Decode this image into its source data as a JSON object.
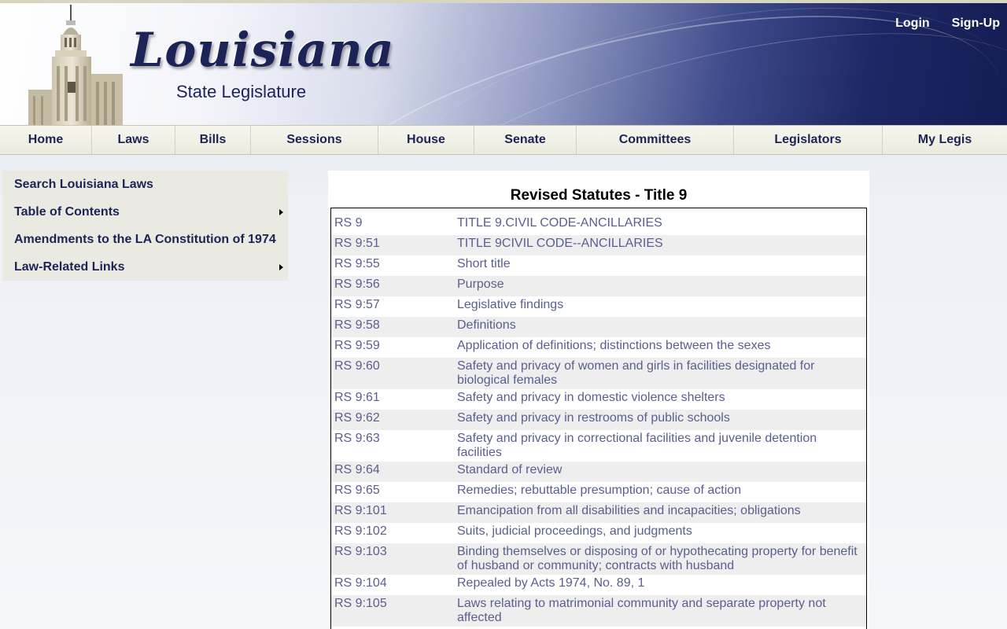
{
  "header": {
    "logo_title": "Louisiana",
    "logo_subtitle": "State Legislature",
    "login": "Login",
    "signup": "Sign-Up"
  },
  "nav": [
    {
      "label": "Home"
    },
    {
      "label": "Laws"
    },
    {
      "label": "Bills"
    },
    {
      "label": "Sessions"
    },
    {
      "label": "House"
    },
    {
      "label": "Senate"
    },
    {
      "label": "Committees"
    },
    {
      "label": "Legislators"
    },
    {
      "label": "My Legis"
    }
  ],
  "leftmenu": [
    {
      "label": "Search Louisiana Laws",
      "has_submenu": false
    },
    {
      "label": "Table of Contents",
      "has_submenu": true
    },
    {
      "label": "Amendments to the LA Constitution of 1974",
      "has_submenu": false
    },
    {
      "label": "Law-Related Links",
      "has_submenu": true
    }
  ],
  "content": {
    "title": "Revised Statutes - Title 9",
    "rows": [
      {
        "code": "RS 9",
        "title": "TITLE 9.CIVIL CODE-ANCILLARIES"
      },
      {
        "code": "RS 9:51",
        "title": "TITLE 9CIVIL CODE--ANCILLARIES"
      },
      {
        "code": "RS 9:55",
        "title": "Short title"
      },
      {
        "code": "RS 9:56",
        "title": "Purpose"
      },
      {
        "code": "RS 9:57",
        "title": "Legislative findings"
      },
      {
        "code": "RS 9:58",
        "title": "Definitions"
      },
      {
        "code": "RS 9:59",
        "title": "Application of definitions; distinctions between the sexes"
      },
      {
        "code": "RS 9:60",
        "title": "Safety and privacy of women and girls in facilities designated for biological females"
      },
      {
        "code": "RS 9:61",
        "title": "Safety and privacy in domestic violence shelters"
      },
      {
        "code": "RS 9:62",
        "title": "Safety and privacy in restrooms of public schools"
      },
      {
        "code": "RS 9:63",
        "title": "Safety and privacy in correctional facilities and juvenile detention facilities"
      },
      {
        "code": "RS 9:64",
        "title": "Standard of review"
      },
      {
        "code": "RS 9:65",
        "title": "Remedies; rebuttable presumption; cause of action"
      },
      {
        "code": "RS 9:101",
        "title": "Emancipation from all disabilities and incapacities; obligations"
      },
      {
        "code": "RS 9:102",
        "title": "Suits, judicial proceedings, and judgments"
      },
      {
        "code": "RS 9:103",
        "title": "Binding themselves or disposing of or hypothecating property for benefit of husband or community; contracts with husband"
      },
      {
        "code": "RS 9:104",
        "title": "Repealed by Acts 1974, No. 89, 1"
      },
      {
        "code": "RS 9:105",
        "title": "Laws relating to matrimonial community and separate property not affected"
      }
    ]
  },
  "colors": {
    "brand_navy": "#1c2356",
    "link": "#5a5e8f",
    "nav_bg": "#ecebdf",
    "row_alt": "#eeeeee"
  }
}
